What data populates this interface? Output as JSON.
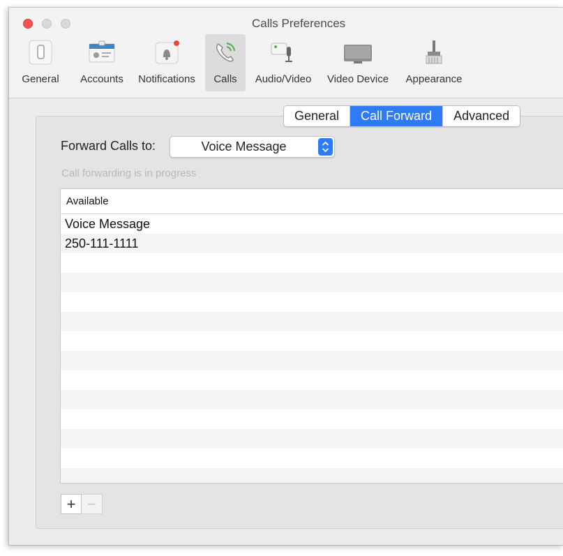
{
  "window": {
    "title": "Calls Preferences"
  },
  "toolbar": {
    "items": [
      {
        "label": "General",
        "icon": "phone-device-icon"
      },
      {
        "label": "Accounts",
        "icon": "id-card-icon"
      },
      {
        "label": "Notifications",
        "icon": "bell-icon"
      },
      {
        "label": "Calls",
        "icon": "phone-call-icon",
        "selected": true
      },
      {
        "label": "Audio/Video",
        "icon": "camera-mic-icon"
      },
      {
        "label": "Video Device",
        "icon": "video-device-icon"
      },
      {
        "label": "Appearance",
        "icon": "brush-icon"
      }
    ]
  },
  "tabs": [
    {
      "label": "General"
    },
    {
      "label": "Call Forward",
      "active": true
    },
    {
      "label": "Advanced"
    }
  ],
  "forward": {
    "label": "Forward Calls to:",
    "selected_value": "Voice Message",
    "status": "Call forwarding is in progress"
  },
  "table": {
    "header": "Available",
    "rows": [
      "Voice Message",
      "250-111-1111"
    ]
  },
  "buttons": {
    "add": "+",
    "remove": "−"
  },
  "colors": {
    "accent": "#2f7bf6",
    "close": "#f2544d",
    "badge": "#e8483f",
    "green": "#46b04a"
  }
}
